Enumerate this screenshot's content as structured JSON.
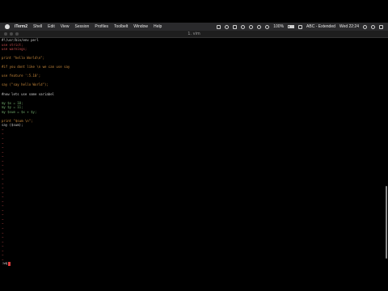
{
  "menubar": {
    "items": [
      "iTerm2",
      "Shell",
      "Edit",
      "View",
      "Session",
      "Profiles",
      "Toolbelt",
      "Window",
      "Help"
    ],
    "status": {
      "battery": "100%",
      "input_source": "ABC - Extended",
      "clock": "Wed 22:24"
    }
  },
  "window": {
    "title": "1. vim"
  },
  "editor": {
    "lines": [
      {
        "text": "#!/usr/bin/env perl",
        "color": "plain"
      },
      {
        "text": "use strict;",
        "color": "red"
      },
      {
        "text": "use warnings;",
        "color": "red"
      },
      {
        "text": "",
        "color": "plain"
      },
      {
        "text": "print \"hello World\\n\";",
        "color": "orange"
      },
      {
        "text": "",
        "color": "plain"
      },
      {
        "text": "#if you dont like \\n we can use say",
        "color": "orange"
      },
      {
        "text": "",
        "color": "plain"
      },
      {
        "text": "use feature ':5.10';",
        "color": "orange"
      },
      {
        "text": "",
        "color": "plain"
      },
      {
        "text": "say (\"say hello World\");",
        "color": "orange"
      },
      {
        "text": "",
        "color": "plain"
      },
      {
        "text": "#now lets use some variabel",
        "color": "plain"
      },
      {
        "text": "",
        "color": "plain"
      },
      {
        "text": "my $x = 10;",
        "color": "green"
      },
      {
        "text": "my $y = 11;",
        "color": "green"
      },
      {
        "text": "my $sum = $x + $y;",
        "color": "green"
      },
      {
        "text": "",
        "color": "plain"
      },
      {
        "text": "print \"$sum \\n\";",
        "color": "orange"
      },
      {
        "text": "say ($sum);",
        "color": "plain"
      }
    ],
    "tilde_count": 30,
    "command_line": ":wq"
  }
}
